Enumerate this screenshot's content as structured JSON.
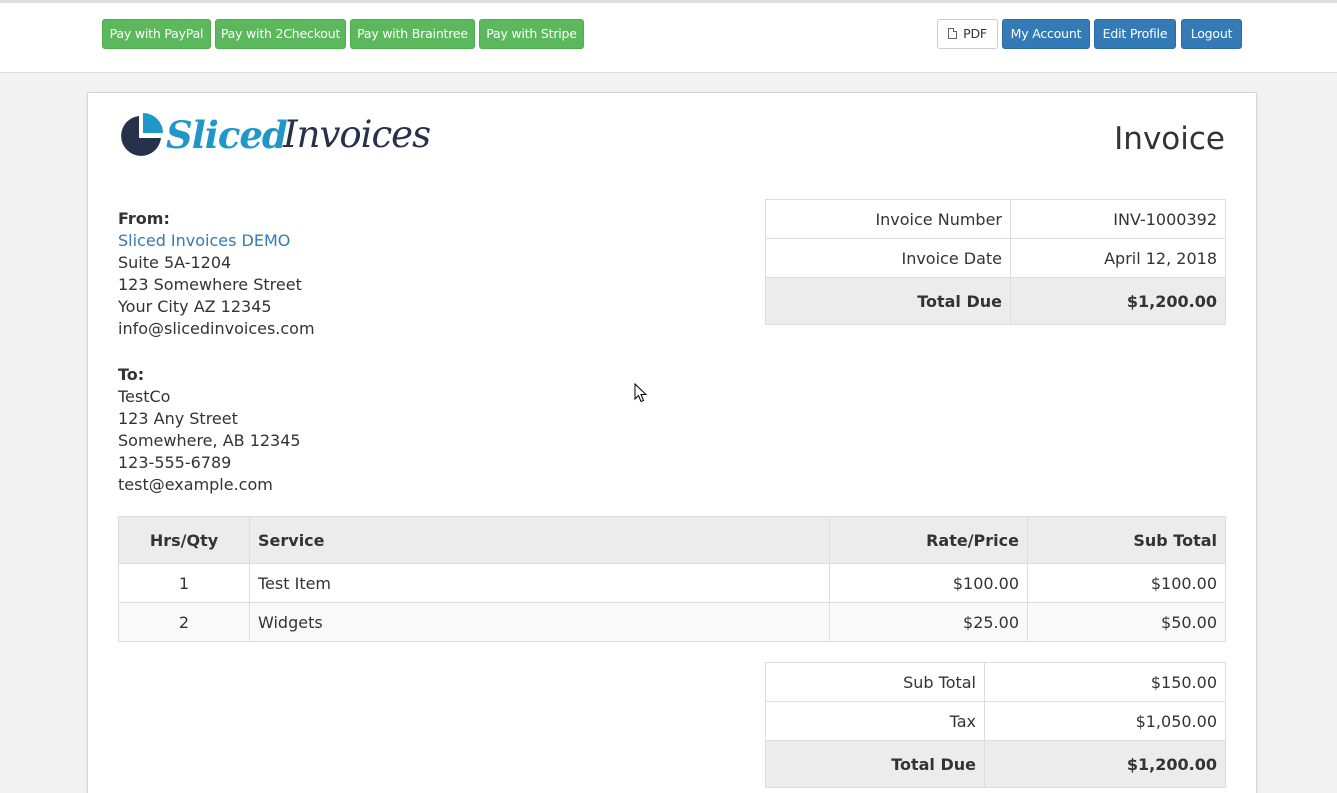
{
  "toolbar": {
    "pay_paypal": "Pay with PayPal",
    "pay_2checkout": "Pay with 2Checkout",
    "pay_braintree": "Pay with Braintree",
    "pay_stripe": "Pay with Stripe",
    "pdf": "PDF",
    "my_account": "My Account",
    "edit_profile": "Edit Profile",
    "logout": "Logout"
  },
  "logo": {
    "part1": "Sliced",
    "part2": "Invoices"
  },
  "title": "Invoice",
  "from": {
    "label": "From:",
    "name": "Sliced Invoices DEMO",
    "line1": "Suite 5A-1204",
    "line2": "123 Somewhere Street",
    "line3": "Your City AZ 12345",
    "email": "info@slicedinvoices.com"
  },
  "to": {
    "label": "To:",
    "name": "TestCo",
    "line1": "123 Any Street",
    "line2": "Somewhere, AB 12345",
    "phone": "123-555-6789",
    "email": "test@example.com"
  },
  "meta": {
    "invoice_number_label": "Invoice Number",
    "invoice_number": "INV-1000392",
    "invoice_date_label": "Invoice Date",
    "invoice_date": "April 12, 2018",
    "total_due_label": "Total Due",
    "total_due": "$1,200.00"
  },
  "items": {
    "headers": [
      "Hrs/Qty",
      "Service",
      "Rate/Price",
      "Sub Total"
    ],
    "rows": [
      {
        "qty": "1",
        "service": "Test Item",
        "rate": "$100.00",
        "subtotal": "$100.00"
      },
      {
        "qty": "2",
        "service": "Widgets",
        "rate": "$25.00",
        "subtotal": "$50.00"
      }
    ]
  },
  "totals": {
    "subtotal_label": "Sub Total",
    "subtotal": "$150.00",
    "tax_label": "Tax",
    "tax": "$1,050.00",
    "total_due_label": "Total Due",
    "total_due": "$1,200.00"
  },
  "colors": {
    "green": "#5cb85c",
    "blue": "#337ab7",
    "logo_blue": "#2196c9",
    "logo_dark": "#26314a"
  },
  "icons": [
    "file-pdf-icon",
    "logo-pie-icon",
    "mouse-cursor-icon"
  ]
}
